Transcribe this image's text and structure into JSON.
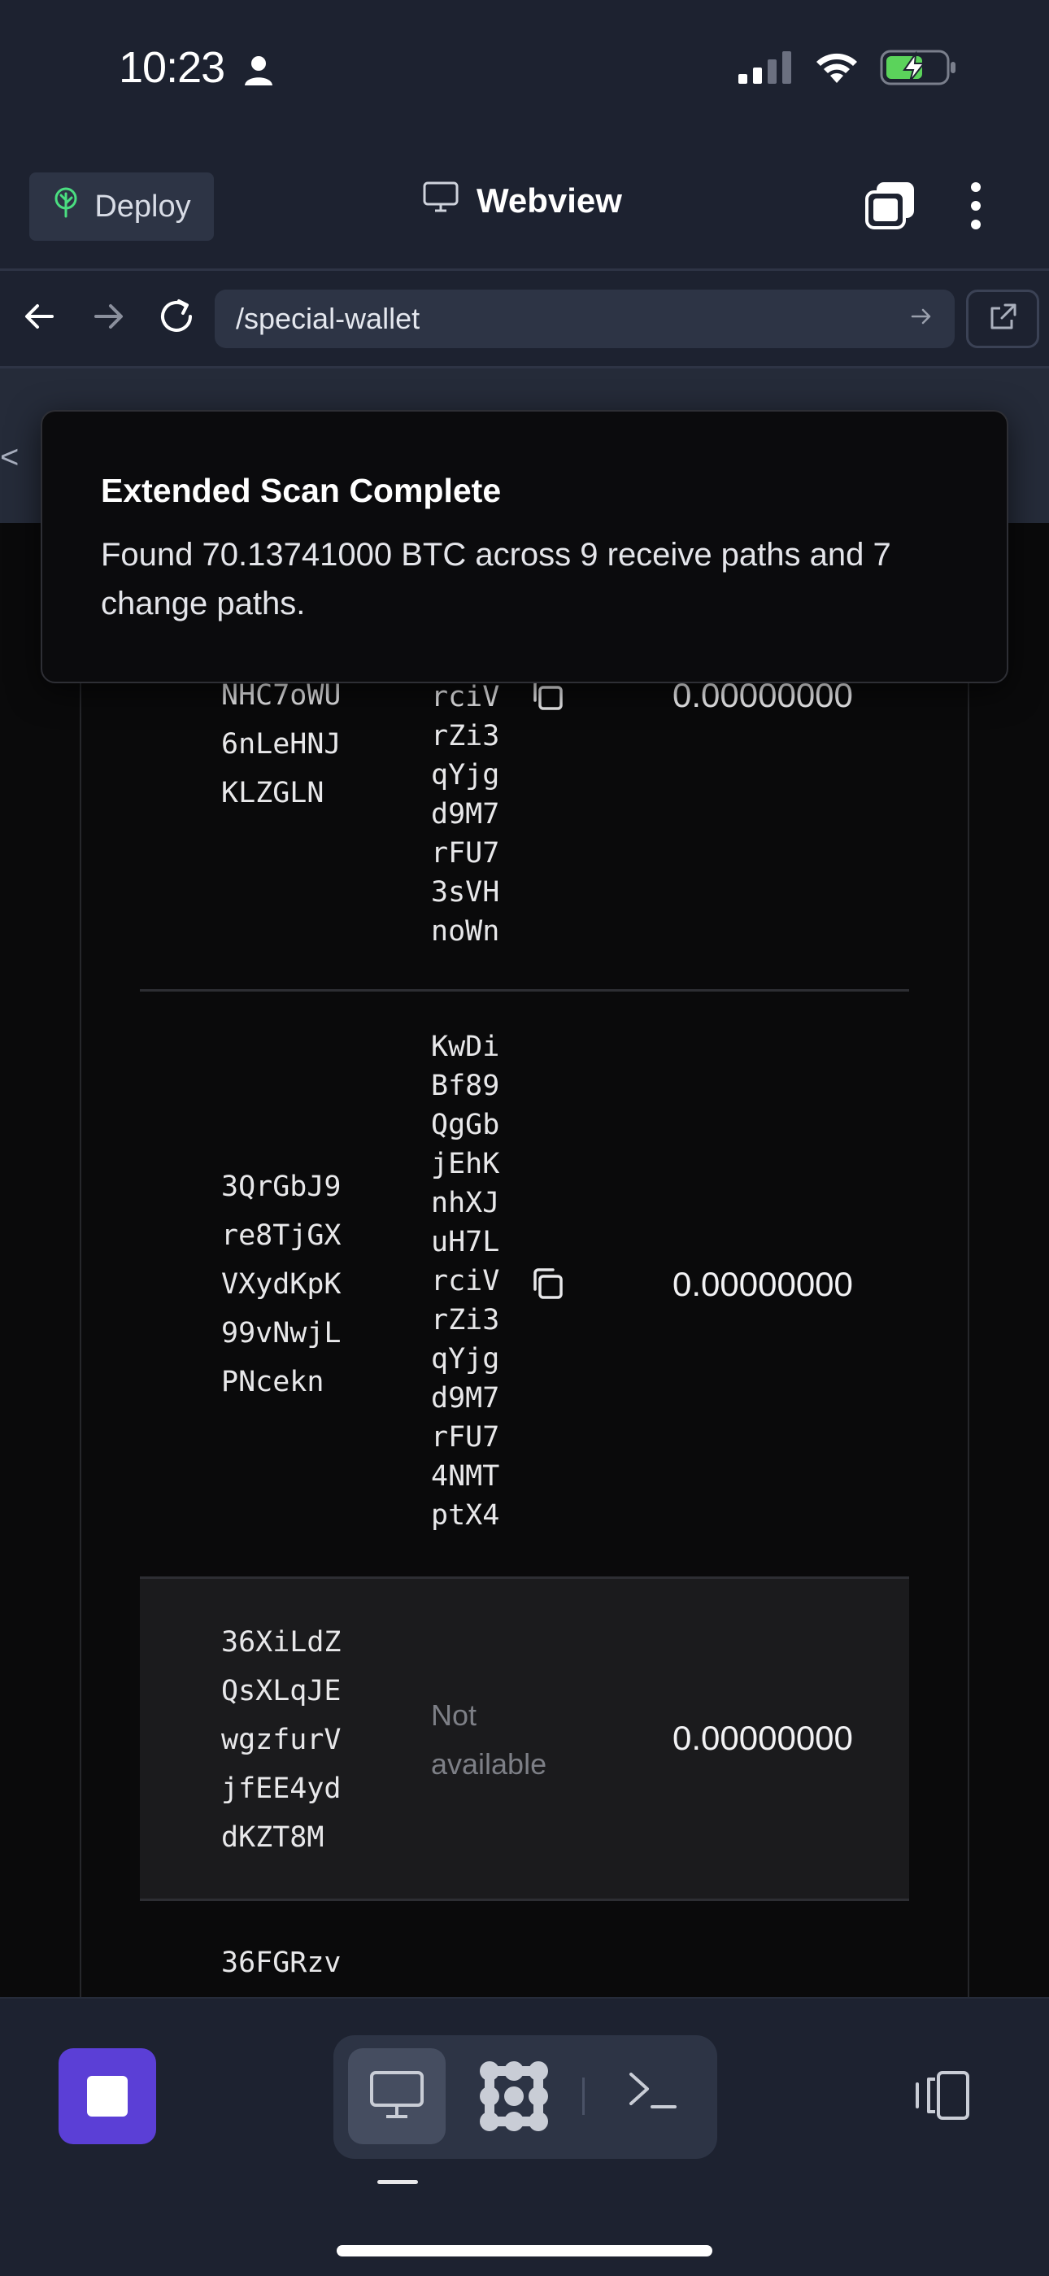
{
  "status_bar": {
    "time": "10:23"
  },
  "header": {
    "deploy_label": "Deploy",
    "title": "Webview"
  },
  "url_bar": {
    "path": "/special-wallet"
  },
  "toast": {
    "title": "Extended Scan Complete",
    "message": "Found 70.13741000 BTC across 9 receive paths and 7 change paths."
  },
  "web_edge_char": "<",
  "rows": [
    {
      "address": "NHC7oWU\n6nLeHNJ\nKLZGLN",
      "key": "rciV\nrZi3\nqYjg\nd9M7\nrFU7\n3sVH\nnoWn",
      "balance": "0.00000000"
    },
    {
      "address": "3QrGbJ9\nre8TjGX\nVXydKpK\n99vNwjL\nPNcekn",
      "key": "KwDi\nBf89\nQgGb\njEhK\nnhXJ\nuH7L\nrciV\nrZi3\nqYjg\nd9M7\nrFU7\n4NMT\nptX4",
      "balance": "0.00000000"
    },
    {
      "address": "36XiLdZ\nQsXLqJE\nwgzfurV\njfEE4yd\ndKZT8M",
      "key_unavailable": "Not\navailable",
      "balance": "0.00000000"
    },
    {
      "address": "36FGRzv"
    }
  ],
  "colors": {
    "app_bg": "#1d2230",
    "accent_purple": "#5b3fd6",
    "deploy_icon": "#4ade80",
    "battery_charge": "#5bd35b"
  }
}
